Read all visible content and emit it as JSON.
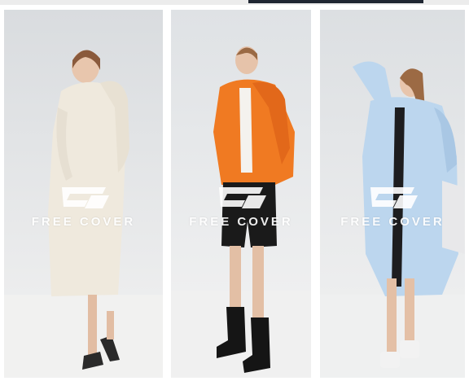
{
  "brand": {
    "wordmark": "FREE COVER",
    "icon": "brand-logo-icon"
  },
  "photos": [
    {
      "subject": "model in cream long puffer coat",
      "colors": {
        "coat": "#efe9dd",
        "bg": "#e3e5e6"
      }
    },
    {
      "subject": "model in orange cropped puffer jacket",
      "colors": {
        "coat": "#f07a22",
        "bg": "#e6e8ea"
      }
    },
    {
      "subject": "model in light blue long puffer coat",
      "colors": {
        "coat": "#bcd6ee",
        "bg": "#e2e4e6"
      }
    }
  ]
}
